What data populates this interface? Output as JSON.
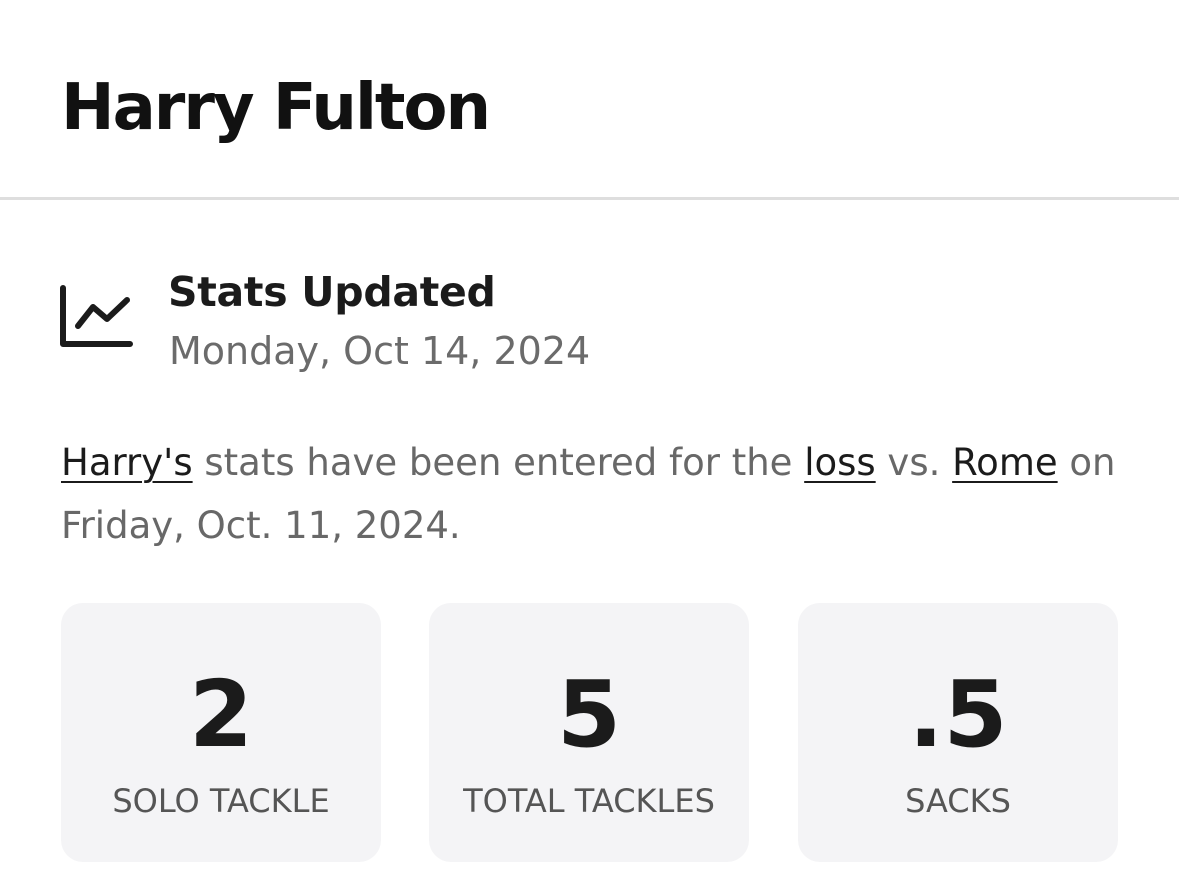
{
  "player": {
    "name": "Harry Fulton"
  },
  "update": {
    "icon": "line-chart-icon",
    "title": "Stats Updated",
    "date": "Monday, Oct 14, 2024"
  },
  "summary": {
    "player_link": "Harry's",
    "text_1": " stats have been entered for the ",
    "result_link": "loss",
    "text_2": " vs. ",
    "opponent_link": "Rome",
    "text_3": " on Friday, Oct. 11, 2024."
  },
  "stats": [
    {
      "value": "2",
      "label": "SOLO TACKLE"
    },
    {
      "value": "5",
      "label": "TOTAL TACKLES"
    },
    {
      "value": ".5",
      "label": "SACKS"
    }
  ]
}
